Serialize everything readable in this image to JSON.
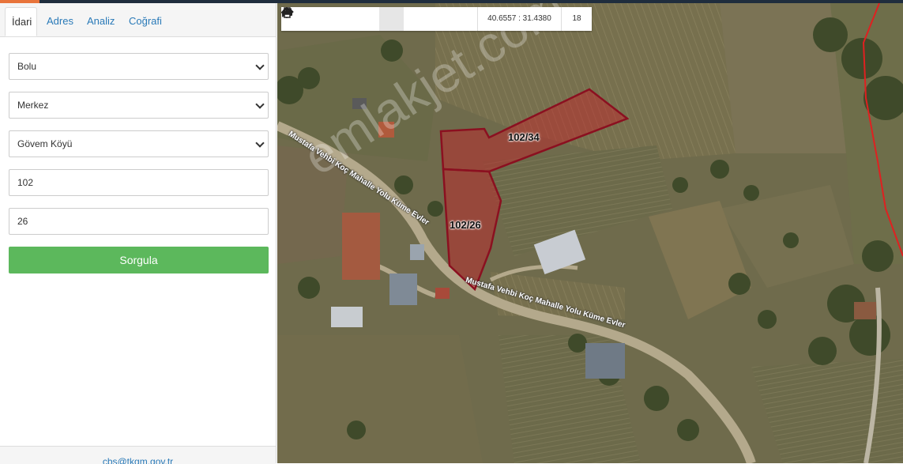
{
  "tabs": [
    "İdari",
    "Adres",
    "Analiz",
    "Coğrafi"
  ],
  "form": {
    "il": "Bolu",
    "ilce": "Merkez",
    "mahalle": "Gövem Köyü",
    "ada": "102",
    "parsel": "26",
    "submit_label": "Sorgula"
  },
  "footer_email": "cbs@tkgm.gov.tr",
  "toolbar": {
    "coords": "40.6557 : 31.4380",
    "zoom": "18"
  },
  "map": {
    "parcel_labels": [
      "102/34",
      "102/26"
    ],
    "road_labels": [
      "Mustafa Vehbi Koç Mahalle Yolu Küme Evler",
      "Mustafa Vehbi Koç Mahalle Yolu Küme Evler"
    ],
    "watermark": "emlakjet.com"
  },
  "colors": {
    "submit_button": "#5cb85c",
    "link": "#2a7ab8",
    "parcel_outline": "#8b1020",
    "boundary_line": "#e02020"
  }
}
